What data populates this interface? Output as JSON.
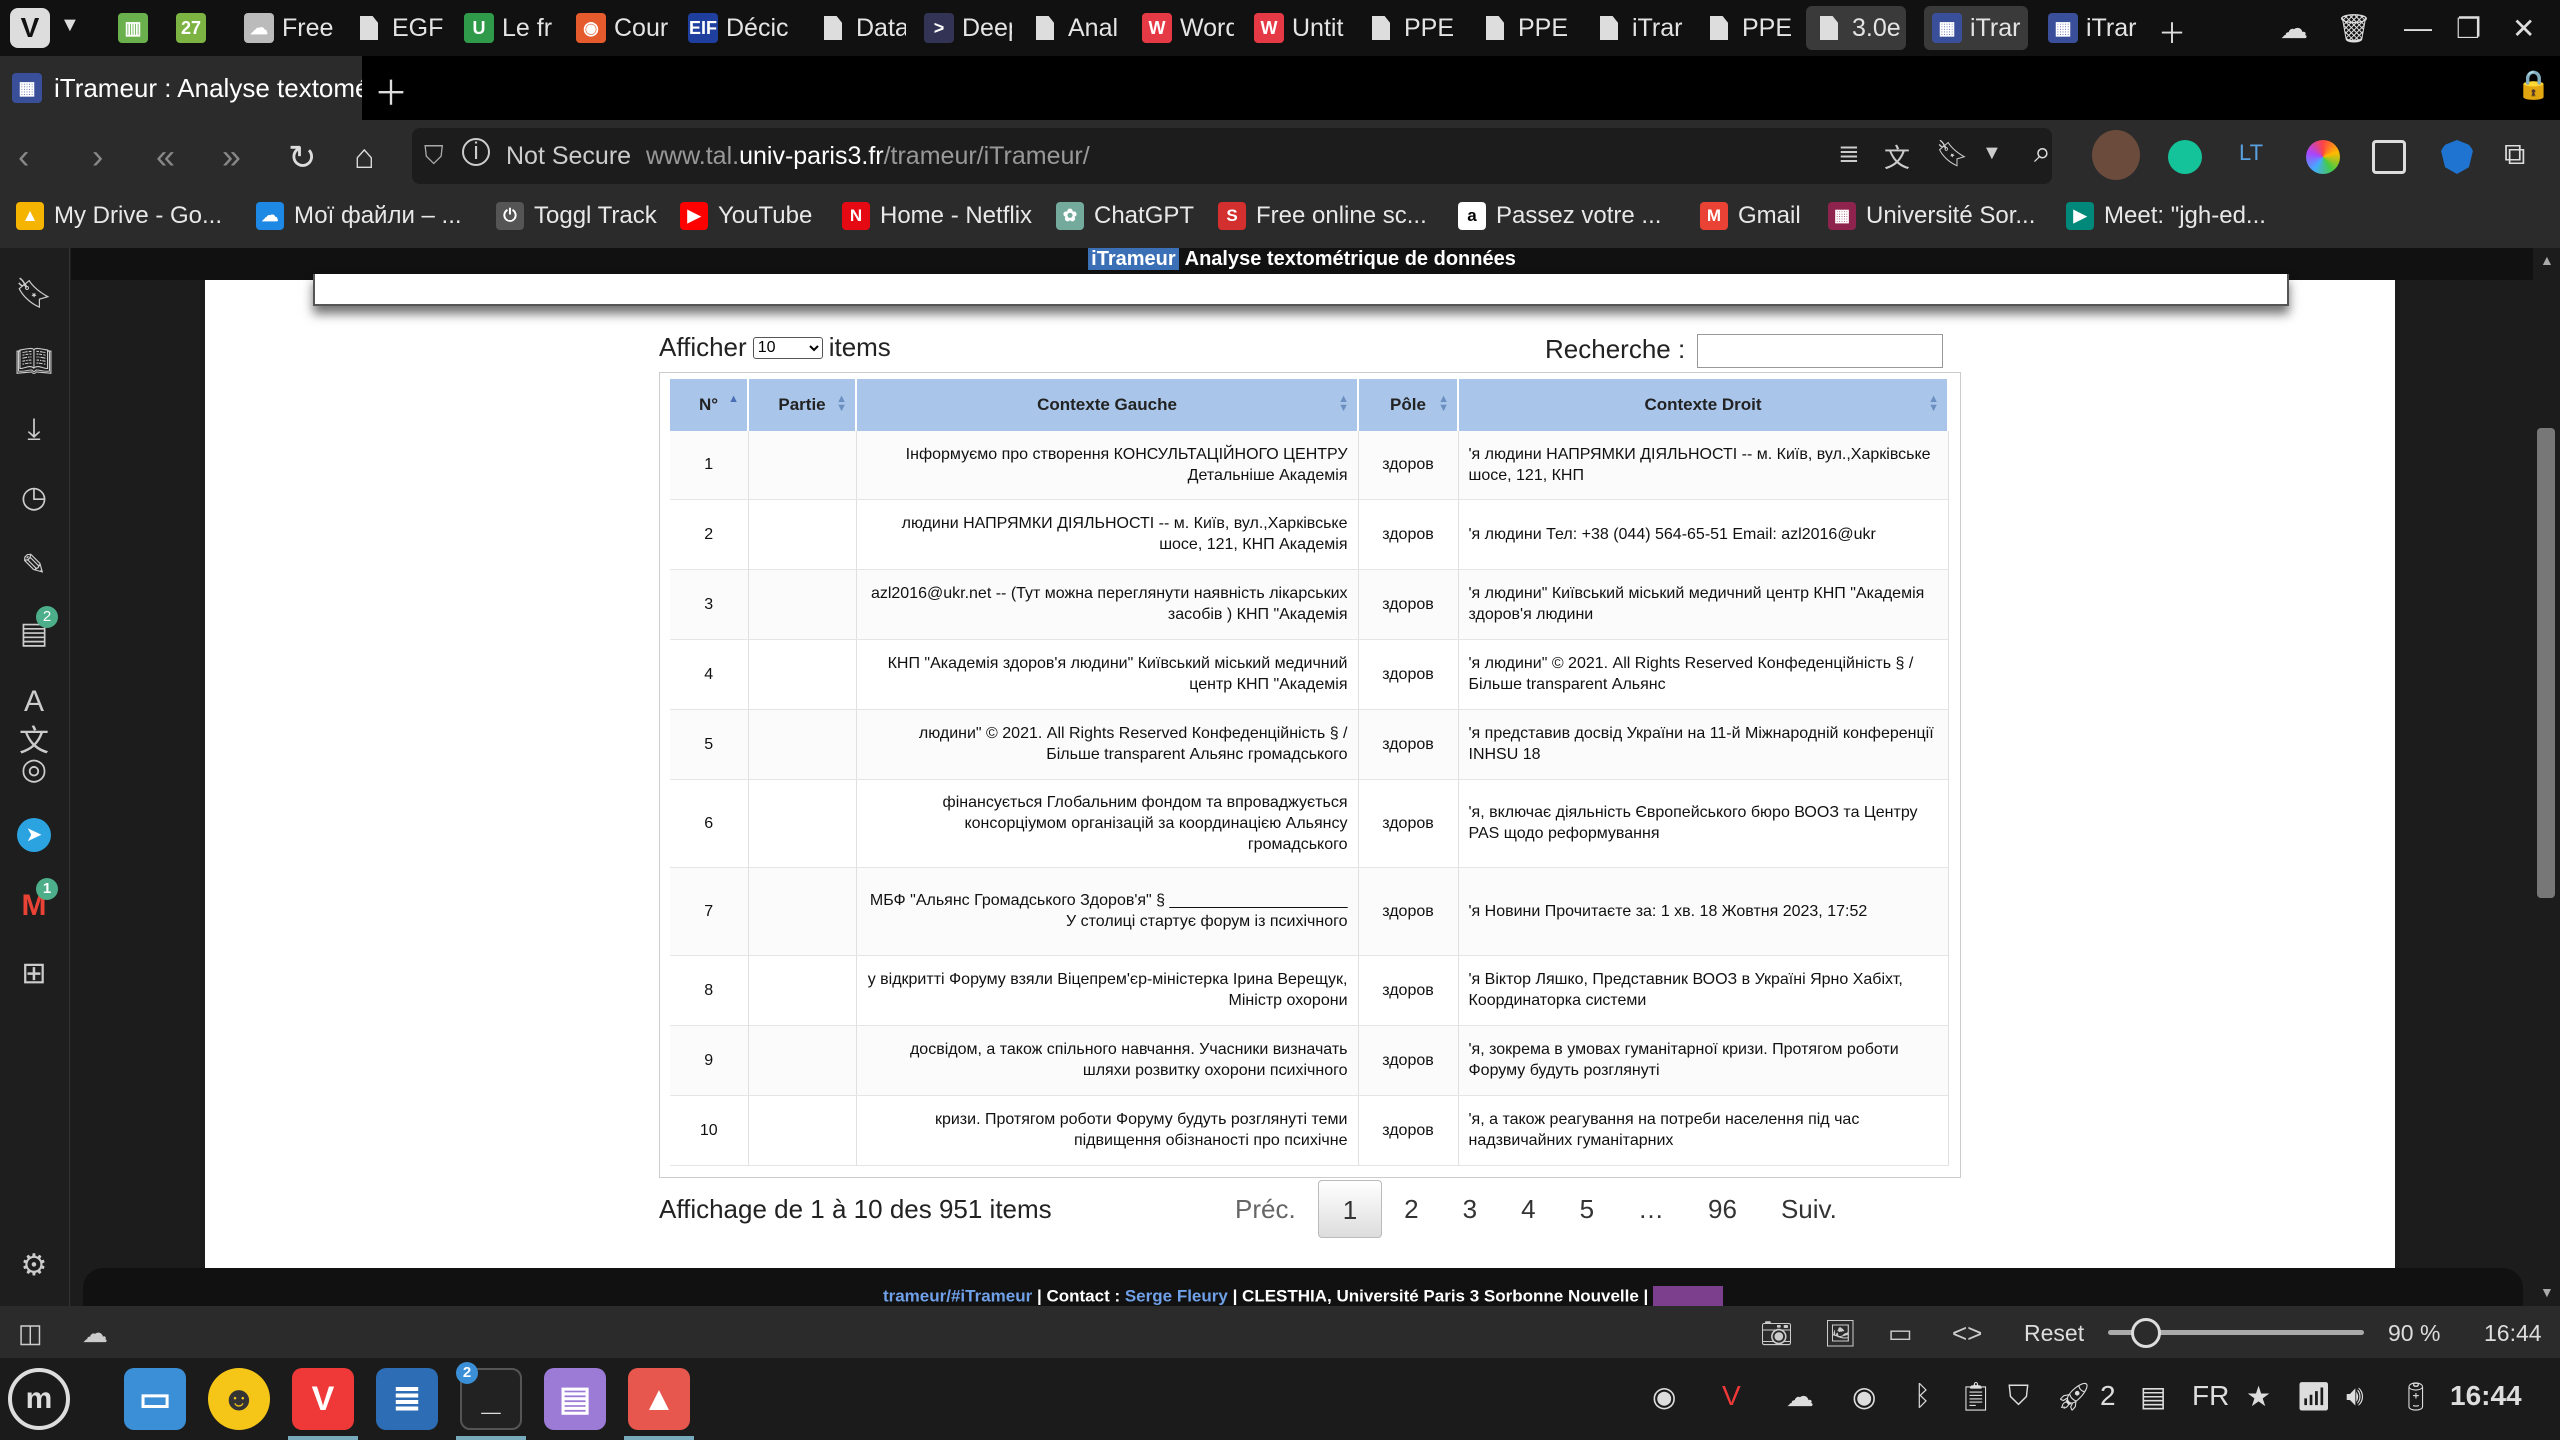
{
  "tabs": {
    "items": [
      {
        "label": "",
        "color": "#6ab04c",
        "glyph": "▥"
      },
      {
        "label": "",
        "color": "#7cb342",
        "glyph": "27"
      },
      {
        "label": "Free",
        "color": "#bbbbbb",
        "glyph": "☁"
      },
      {
        "label": "EGF",
        "color": "",
        "glyph": "doc"
      },
      {
        "label": "Le fr",
        "color": "#2e9a4a",
        "glyph": "U"
      },
      {
        "label": "Cour",
        "color": "#e55b2d",
        "glyph": "◉"
      },
      {
        "label": "Décic",
        "color": "#1f3f9e",
        "glyph": "EIF"
      },
      {
        "label": "Data",
        "color": "",
        "glyph": "doc"
      },
      {
        "label": "Deep",
        "color": "#333355",
        "glyph": ">"
      },
      {
        "label": "Anal",
        "color": "",
        "glyph": "doc"
      },
      {
        "label": "Word",
        "color": "#e63946",
        "glyph": "W"
      },
      {
        "label": "Untit",
        "color": "#e63946",
        "glyph": "W"
      },
      {
        "label": "PPE",
        "color": "",
        "glyph": "doc"
      },
      {
        "label": "PPE",
        "color": "",
        "glyph": "doc"
      },
      {
        "label": "iTrar",
        "color": "",
        "glyph": "doc"
      },
      {
        "label": "PPE",
        "color": "",
        "glyph": "doc"
      },
      {
        "label": "3.0e",
        "color": "",
        "glyph": "doc"
      },
      {
        "label": "iTrar",
        "color": "#3a4f9a",
        "glyph": "▦"
      },
      {
        "label": "iTrar",
        "color": "#3a4f9a",
        "glyph": "▦"
      }
    ],
    "current_tab": "iTrameur : Analyse textométr"
  },
  "address": {
    "security": "Not Secure",
    "url_prefix": "www.tal.",
    "url_domain": "univ-paris3.fr",
    "url_path": "/trameur/iTrameur/"
  },
  "bookmarks": [
    {
      "label": "My Drive - Go...",
      "color": "#f4b400",
      "glyph": "▲"
    },
    {
      "label": "Мої файли – ...",
      "color": "#1e88e5",
      "glyph": "☁"
    },
    {
      "label": "Toggl Track",
      "color": "#555555",
      "glyph": "⏻"
    },
    {
      "label": "YouTube",
      "color": "#ff0000",
      "glyph": "▶"
    },
    {
      "label": "Home - Netflix",
      "color": "#e50914",
      "glyph": "N"
    },
    {
      "label": "ChatGPT",
      "color": "#74aa9c",
      "glyph": "✿"
    },
    {
      "label": "Free online sc...",
      "color": "#d32f2f",
      "glyph": "S"
    },
    {
      "label": "Passez votre ...",
      "color": "#ffffff",
      "glyph": "a"
    },
    {
      "label": "Gmail",
      "color": "#ea4335",
      "glyph": "M"
    },
    {
      "label": "Université Sor...",
      "color": "#8e244d",
      "glyph": "▦"
    },
    {
      "label": "Meet: \"jgh-ed...",
      "color": "#00897b",
      "glyph": "▶"
    }
  ],
  "banner": {
    "logo": "iTrameur",
    "title": "Analyse textométrique de données"
  },
  "controls": {
    "show_before": "Afficher",
    "page_length": "10",
    "show_after": "items",
    "search_label": "Recherche :",
    "search_value": ""
  },
  "table": {
    "headers": {
      "num": "N°",
      "partie": "Partie",
      "left": "Contexte Gauche",
      "pole": "Pôle",
      "right": "Contexte Droit"
    },
    "rows": [
      {
        "n": "1",
        "partie": "",
        "left": "Інформуємо про створення КОНСУЛЬТАЦІЙНОГО ЦЕНТРУ Детальніше Академія",
        "pole": "здоров",
        "right": "'я людини НАПРЯМКИ ДІЯЛЬНОСТІ -- м. Київ, вул.,Харківське шосе, 121, КНП"
      },
      {
        "n": "2",
        "partie": "",
        "left": "людини НАПРЯМКИ ДІЯЛЬНОСТІ -- м. Київ, вул.,Харківське шосе, 121, КНП Академія",
        "pole": "здоров",
        "right": "'я людини Тел: +38 (044) 564-65-51 Email: azl2016@ukr"
      },
      {
        "n": "3",
        "partie": "",
        "left": "azl2016@ukr.net -- (Тут можна переглянути наявність лікарських засобів ) КНП \"Академія",
        "pole": "здоров",
        "right": "'я людини\" Київський міський медичний центр КНП \"Академія здоров'я людини"
      },
      {
        "n": "4",
        "partie": "",
        "left": "КНП \"Академія здоров'я людини\" Київський міський медичний центр КНП \"Академія",
        "pole": "здоров",
        "right": "'я людини\" © 2021. All Rights Reserved Конфеденційність § / Більше transparent Альянс"
      },
      {
        "n": "5",
        "partie": "",
        "left": "людини\" © 2021. All Rights Reserved Конфеденційність § / Більше transparent Альянс громадського",
        "pole": "здоров",
        "right": "'я представив досвід України на 11-й Міжнародній конференції INHSU 18"
      },
      {
        "n": "6",
        "partie": "",
        "left": "фінансується Глобальним фондом та впроваджується консорціумом організацій за координацією Альянсу громадського",
        "pole": "здоров",
        "right": "'я, включає діяльність Європейського бюро ВООЗ та Центру PAS щодо реформування"
      },
      {
        "n": "7",
        "partie": "",
        "left": "МБФ \"Альянс Громадського Здоров'я\" § ____________________ У столиці стартує форум із психічного",
        "pole": "здоров",
        "right": "'я Новини Прочитаєте за: 1 хв. 18 Жовтня 2023, 17:52"
      },
      {
        "n": "8",
        "partie": "",
        "left": "у відкритті Форуму взяли Віцепрем'єр-міністерка Ірина Верещук, Міністр охорони",
        "pole": "здоров",
        "right": "'я Віктор Ляшко, Представник ВООЗ в Україні Ярно Хабіхт, Координаторка системи"
      },
      {
        "n": "9",
        "partie": "",
        "left": "досвідом, а також спільного навчання. Учасники визначать шляхи розвитку охорони психічного",
        "pole": "здоров",
        "right": "'я, зокрема в умовах гуманітарної кризи. Протягом роботи Форуму будуть розглянуті"
      },
      {
        "n": "10",
        "partie": "",
        "left": "кризи. Протягом роботи Форуму будуть розглянуті теми підвищення обізнаності про психічне",
        "pole": "здоров",
        "right": "'я, а також реагування на потреби населення під час надзвичайних гуманітарних"
      }
    ]
  },
  "info": "Affichage de 1 à 10 des 951 items",
  "pager": {
    "prev": "Préc.",
    "p1": "1",
    "p2": "2",
    "p3": "3",
    "p4": "4",
    "p5": "5",
    "ellipsis": "…",
    "last": "96",
    "next": "Suiv."
  },
  "footer": {
    "link1": "trameur/#iTrameur",
    "sep1": " | Contact : ",
    "link2": "Serge Fleury",
    "rest": " | CLESTHIA, Université Paris 3 Sorbonne Nouvelle | "
  },
  "statusbar": {
    "reset": "Reset",
    "zoom": "90 %",
    "clock": "16:44",
    "zoom_level": 0.9
  },
  "taskbar": {
    "badge_terminal": "2",
    "tray_count": "2",
    "lang": "FR",
    "clock": "16:44"
  },
  "sidebar": {
    "badge_calendar": "2",
    "badge_mail": "1"
  }
}
